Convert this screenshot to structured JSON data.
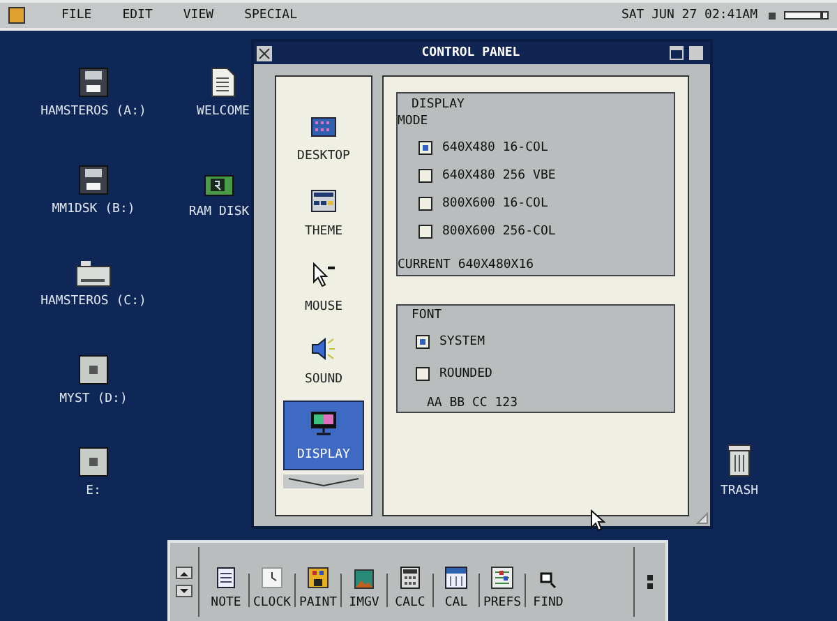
{
  "menu_bar": {
    "items": [
      "FILE",
      "EDIT",
      "VIEW",
      "SPECIAL"
    ],
    "clock": "SAT JUN 27 02:41AM",
    "volume": {
      "level": 0.9
    }
  },
  "desktop_icons": [
    {
      "label": "HAMSTEROS (A:)",
      "kind": "floppy"
    },
    {
      "label": "WELCOME",
      "kind": "document"
    },
    {
      "label": "MM1DSK (B:)",
      "kind": "floppy"
    },
    {
      "label": "RAM DISK",
      "kind": "ram"
    },
    {
      "label": "HAMSTEROS (C:)",
      "kind": "harddisk"
    },
    {
      "label": "MYST (D:)",
      "kind": "cdrom"
    },
    {
      "label": "E:",
      "kind": "cdrom"
    },
    {
      "label": "TRASH",
      "kind": "trash"
    }
  ],
  "window": {
    "title": "CONTROL PANEL",
    "categories": [
      {
        "label": "DESKTOP",
        "kind": "desktop",
        "selected": false
      },
      {
        "label": "THEME",
        "kind": "theme",
        "selected": false
      },
      {
        "label": "MOUSE",
        "kind": "mouse",
        "selected": false
      },
      {
        "label": "SOUND",
        "kind": "sound",
        "selected": false
      },
      {
        "label": "DISPLAY",
        "kind": "display",
        "selected": true
      }
    ],
    "display": {
      "title": "DISPLAY",
      "mode_label": "MODE",
      "modes": [
        {
          "label": "640X480 16-COL",
          "selected": true
        },
        {
          "label": "640X480 256 VBE",
          "selected": false
        },
        {
          "label": "800X600 16-COL",
          "selected": false
        },
        {
          "label": "800X600 256-COL",
          "selected": false
        }
      ],
      "current": "CURRENT 640X480X16"
    },
    "font": {
      "title": "FONT",
      "options": [
        {
          "label": "SYSTEM",
          "selected": true
        },
        {
          "label": "ROUNDED",
          "selected": false
        }
      ],
      "sample": "AA BB CC 123"
    }
  },
  "dock": {
    "apps": [
      {
        "label": "NOTE",
        "kind": "note"
      },
      {
        "label": "CLOCK",
        "kind": "clock"
      },
      {
        "label": "PAINT",
        "kind": "paint"
      },
      {
        "label": "IMGV",
        "kind": "imgv"
      },
      {
        "label": "CALC",
        "kind": "calc"
      },
      {
        "label": "CAL",
        "kind": "cal"
      },
      {
        "label": "PREFS",
        "kind": "prefs"
      },
      {
        "label": "FIND",
        "kind": "find"
      }
    ]
  }
}
